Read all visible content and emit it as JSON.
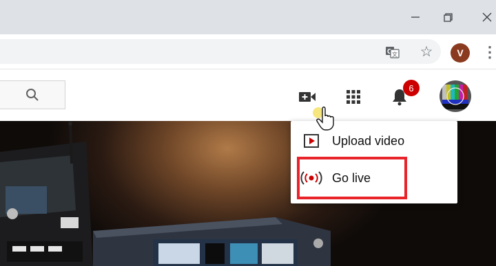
{
  "window": {
    "minimize_glyph": "—",
    "maximize_glyph": "❐",
    "close_glyph": "✕"
  },
  "browser": {
    "profile_initial": "V",
    "menu_glyph": "⋮",
    "star_glyph": "☆"
  },
  "header": {
    "notification_count": "6"
  },
  "create_menu": {
    "items": [
      {
        "label": "Upload video",
        "icon": "upload-video-icon"
      },
      {
        "label": "Go live",
        "icon": "go-live-icon"
      }
    ]
  },
  "colors": {
    "highlight": "#e8232a",
    "badge": "#cc0000",
    "titlebar": "#dee1e6"
  }
}
